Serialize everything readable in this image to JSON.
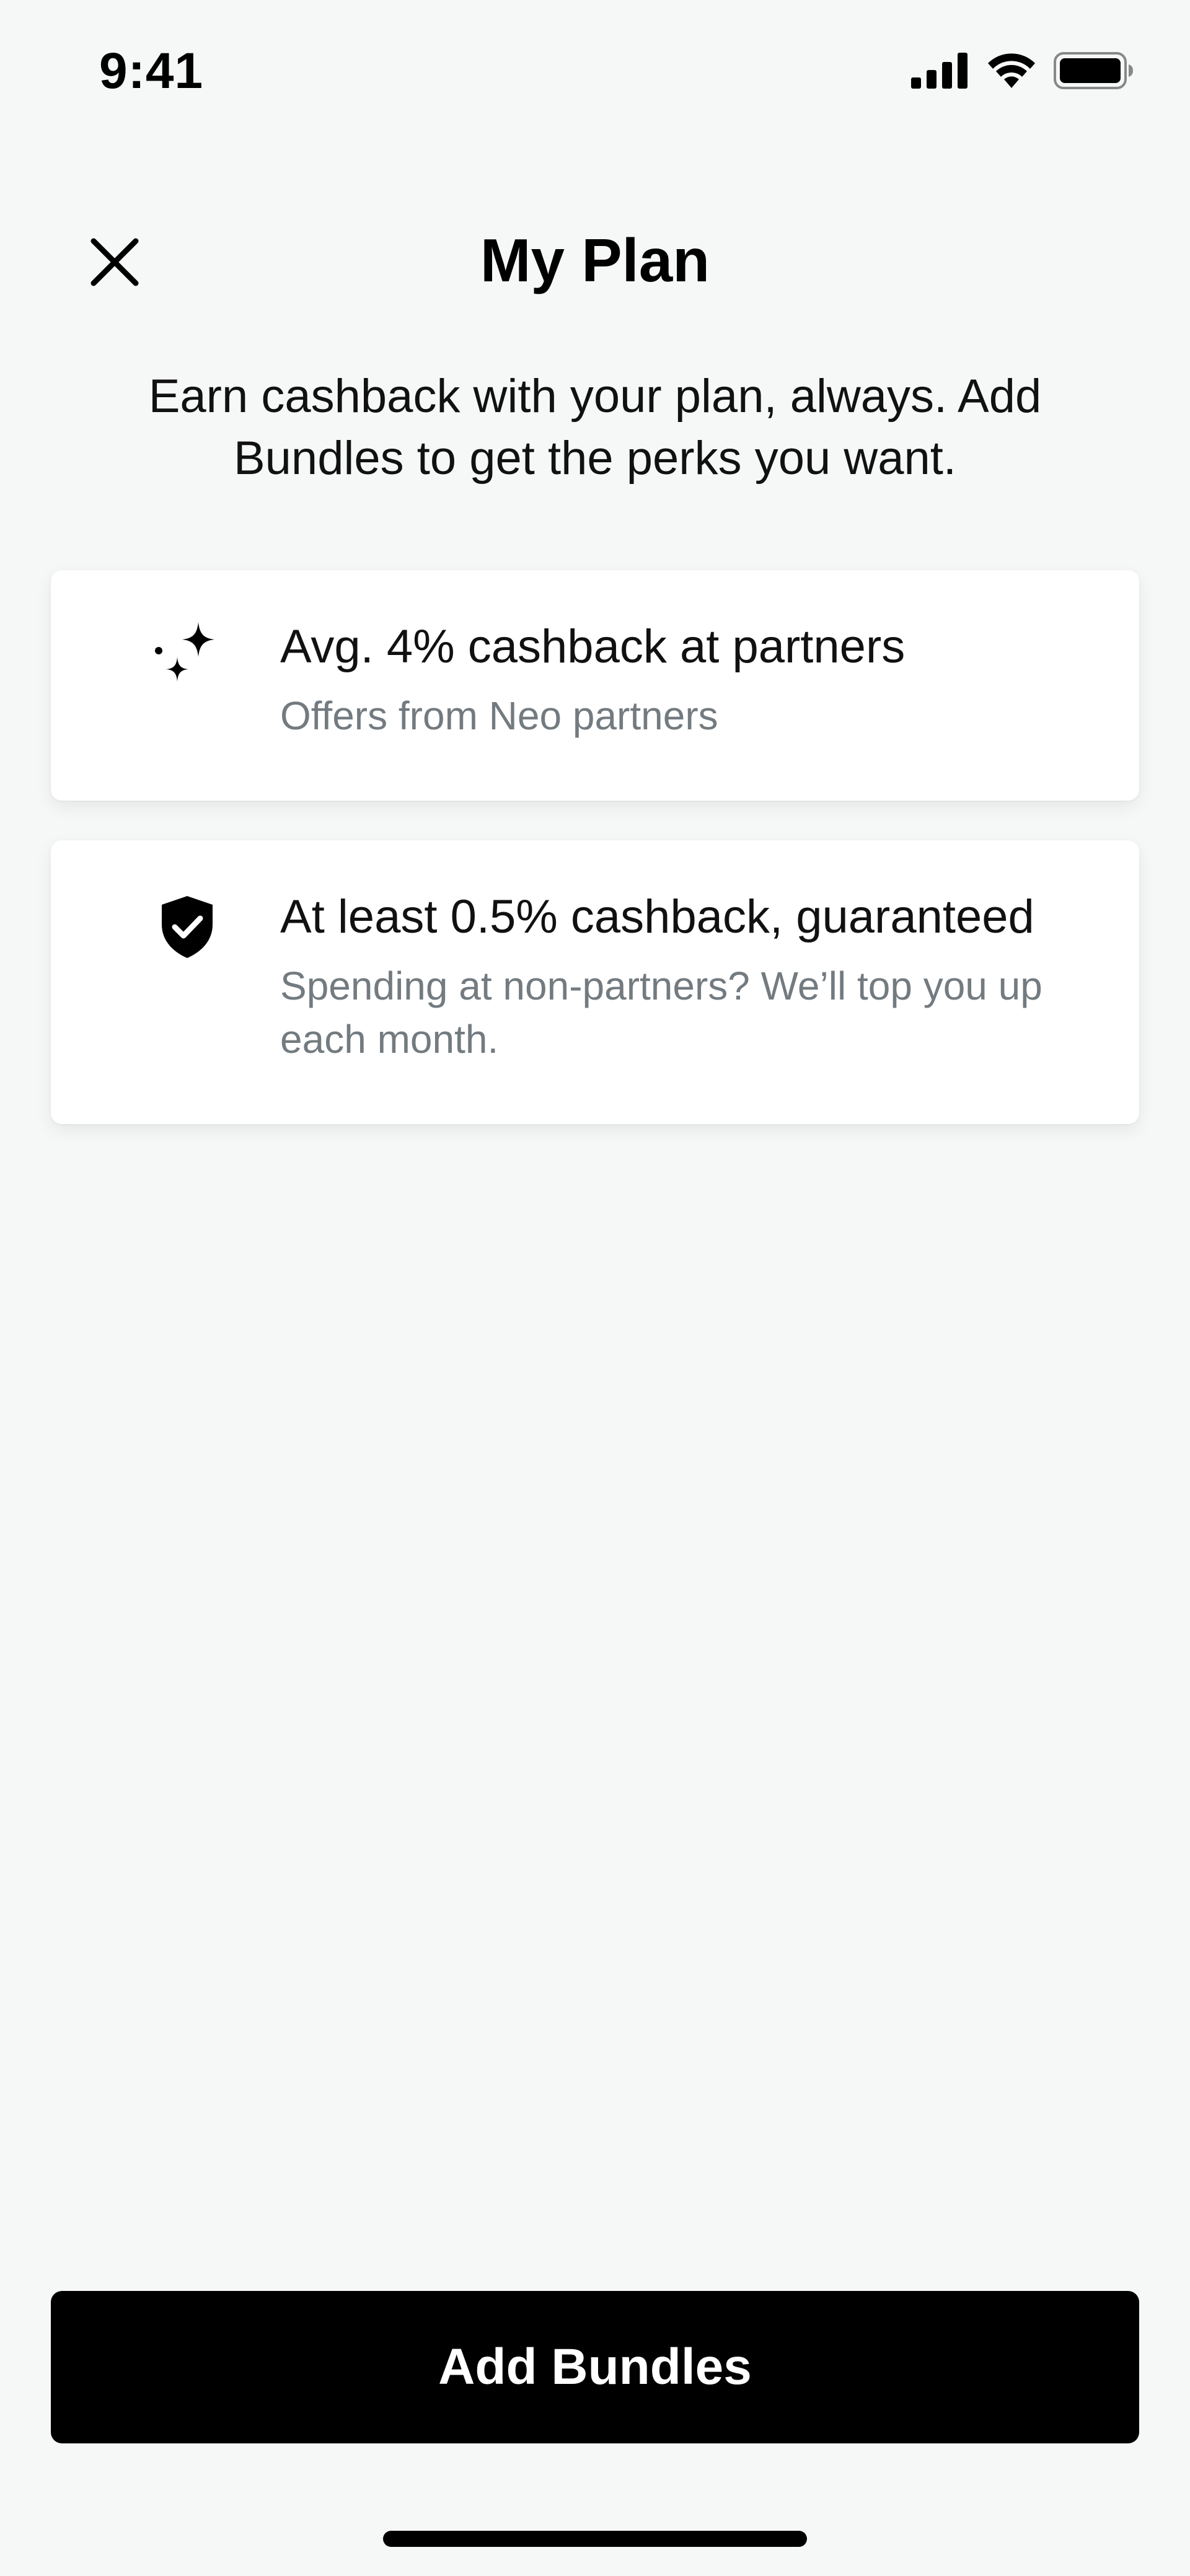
{
  "status_bar": {
    "time": "9:41"
  },
  "header": {
    "title": "My Plan"
  },
  "intro": {
    "text": "Earn cashback with your plan, always. Add Bundles to get the perks you want."
  },
  "cards": [
    {
      "icon": "sparkles-icon",
      "title": "Avg. 4% cashback at partners",
      "subtitle": "Offers from Neo partners"
    },
    {
      "icon": "shield-check-icon",
      "title": "At least 0.5% cashback, guaranteed",
      "subtitle": "Spending at non-partners? We’ll top you up each month."
    }
  ],
  "cta": {
    "label": "Add Bundles"
  },
  "colors": {
    "background": "#f6f8f7",
    "card": "#ffffff",
    "subtitle": "#737b80",
    "button": "#000000",
    "button_text": "#ffffff"
  }
}
